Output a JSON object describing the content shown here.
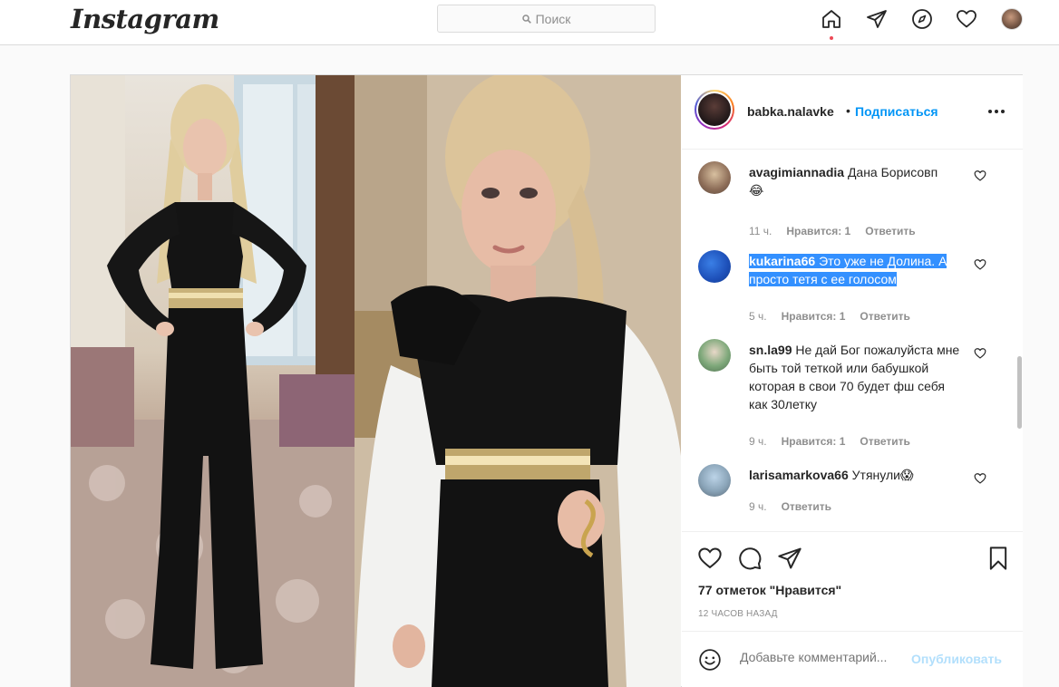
{
  "nav": {
    "logo": "Instagram",
    "search_placeholder": "Поиск",
    "icons": [
      "home-icon",
      "direct-icon",
      "explore-icon",
      "activity-heart-icon",
      "profile-avatar"
    ]
  },
  "post": {
    "username": "babka.nalavke",
    "separator": "•",
    "follow_label": "Подписаться",
    "comments": [
      {
        "user": "avagimiannadia",
        "text": "Дана Борисовп",
        "emoji": "😂",
        "time": "11 ч.",
        "likes": "Нравится: 1",
        "reply": "Ответить"
      },
      {
        "user": "kukarina66",
        "text": "Это уже не Долина. А просто тетя с ее голосом",
        "time": "5 ч.",
        "likes": "Нравится: 1",
        "reply": "Ответить",
        "highlighted": true
      },
      {
        "user": "sn.la99",
        "text": "Не дай Бог пожалуйста мне быть той теткой или бабушкой которая в свои 70 будет фш себя как 30летку",
        "time": "9 ч.",
        "likes": "Нравится: 1",
        "reply": "Ответить"
      },
      {
        "user": "larisamarkova66",
        "text": "Утянули",
        "emoji": "😱",
        "time": "9 ч.",
        "reply": "Ответить"
      }
    ],
    "likes_count": "77 отметок \"Нравится\"",
    "posted_time": "12 ЧАСОВ НАЗАД",
    "add_comment_placeholder": "Добавьте комментарий...",
    "publish_label": "Опубликовать"
  },
  "colors": {
    "accent": "#0095f6",
    "publish_disabled": "#b2dffc",
    "border": "#dbdbdb",
    "notification_dot": "#ed4956",
    "selection": "#3390ff"
  }
}
